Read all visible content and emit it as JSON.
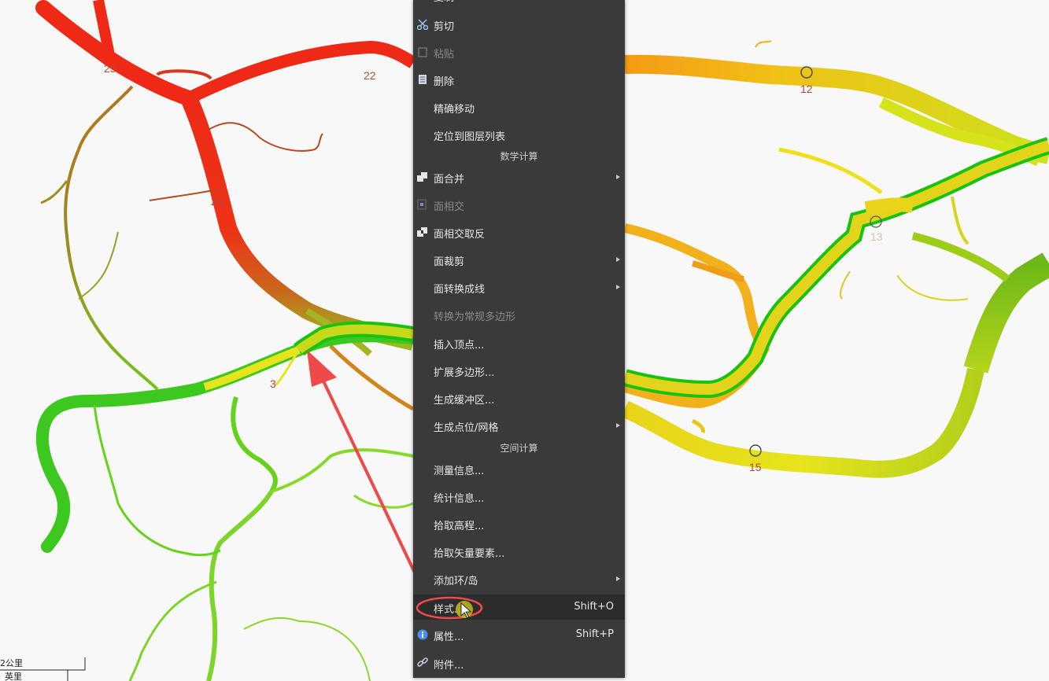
{
  "map": {
    "node_labels": [
      "25",
      "22",
      "23",
      "3",
      "12",
      "13",
      "15"
    ],
    "colors": {
      "red": "#ee2a17",
      "orange": "#f49a14",
      "yellow": "#ece21a",
      "green": "#3cc81e",
      "highlight": "#19c20f"
    },
    "scale_top": "2公里",
    "scale_bottom": "英里"
  },
  "menu": {
    "items": [
      {
        "label": "复制",
        "icon": "copy-icon",
        "disabled": false
      },
      {
        "label": "剪切",
        "icon": "scissors-icon",
        "disabled": false
      },
      {
        "label": "粘贴",
        "icon": "paste-icon",
        "disabled": true
      },
      {
        "label": "删除",
        "icon": "delete-icon",
        "disabled": false
      },
      {
        "label": "精确移动",
        "disabled": false
      },
      {
        "label": "定位到图层列表",
        "disabled": false
      },
      {
        "label": "面合并",
        "icon": "merge-icon",
        "disabled": false,
        "submenu": true
      },
      {
        "label": "面相交",
        "icon": "intersect-icon",
        "disabled": true
      },
      {
        "label": "面相交取反",
        "icon": "xor-icon",
        "disabled": false
      },
      {
        "label": "面裁剪",
        "disabled": false,
        "submenu": true
      },
      {
        "label": "面转换成线",
        "disabled": false,
        "submenu": true
      },
      {
        "label": "转换为常规多边形",
        "disabled": true
      },
      {
        "label": "插入顶点...",
        "disabled": false
      },
      {
        "label": "扩展多边形...",
        "disabled": false
      },
      {
        "label": "生成缓冲区...",
        "disabled": false
      },
      {
        "label": "生成点位/网格",
        "disabled": false,
        "submenu": true
      },
      {
        "label": "测量信息...",
        "disabled": false
      },
      {
        "label": "统计信息...",
        "disabled": false
      },
      {
        "label": "拾取高程...",
        "disabled": false
      },
      {
        "label": "拾取矢量要素...",
        "disabled": false
      },
      {
        "label": "添加环/岛",
        "disabled": false,
        "submenu": true
      },
      {
        "label": "样式...",
        "disabled": false,
        "shortcut": "Shift+O"
      },
      {
        "label": "属性...",
        "icon": "info-icon",
        "disabled": false,
        "shortcut": "Shift+P"
      },
      {
        "label": "附件...",
        "icon": "link-icon",
        "disabled": false
      }
    ],
    "sections": {
      "math": "数学计算",
      "spatial": "空间计算"
    }
  }
}
